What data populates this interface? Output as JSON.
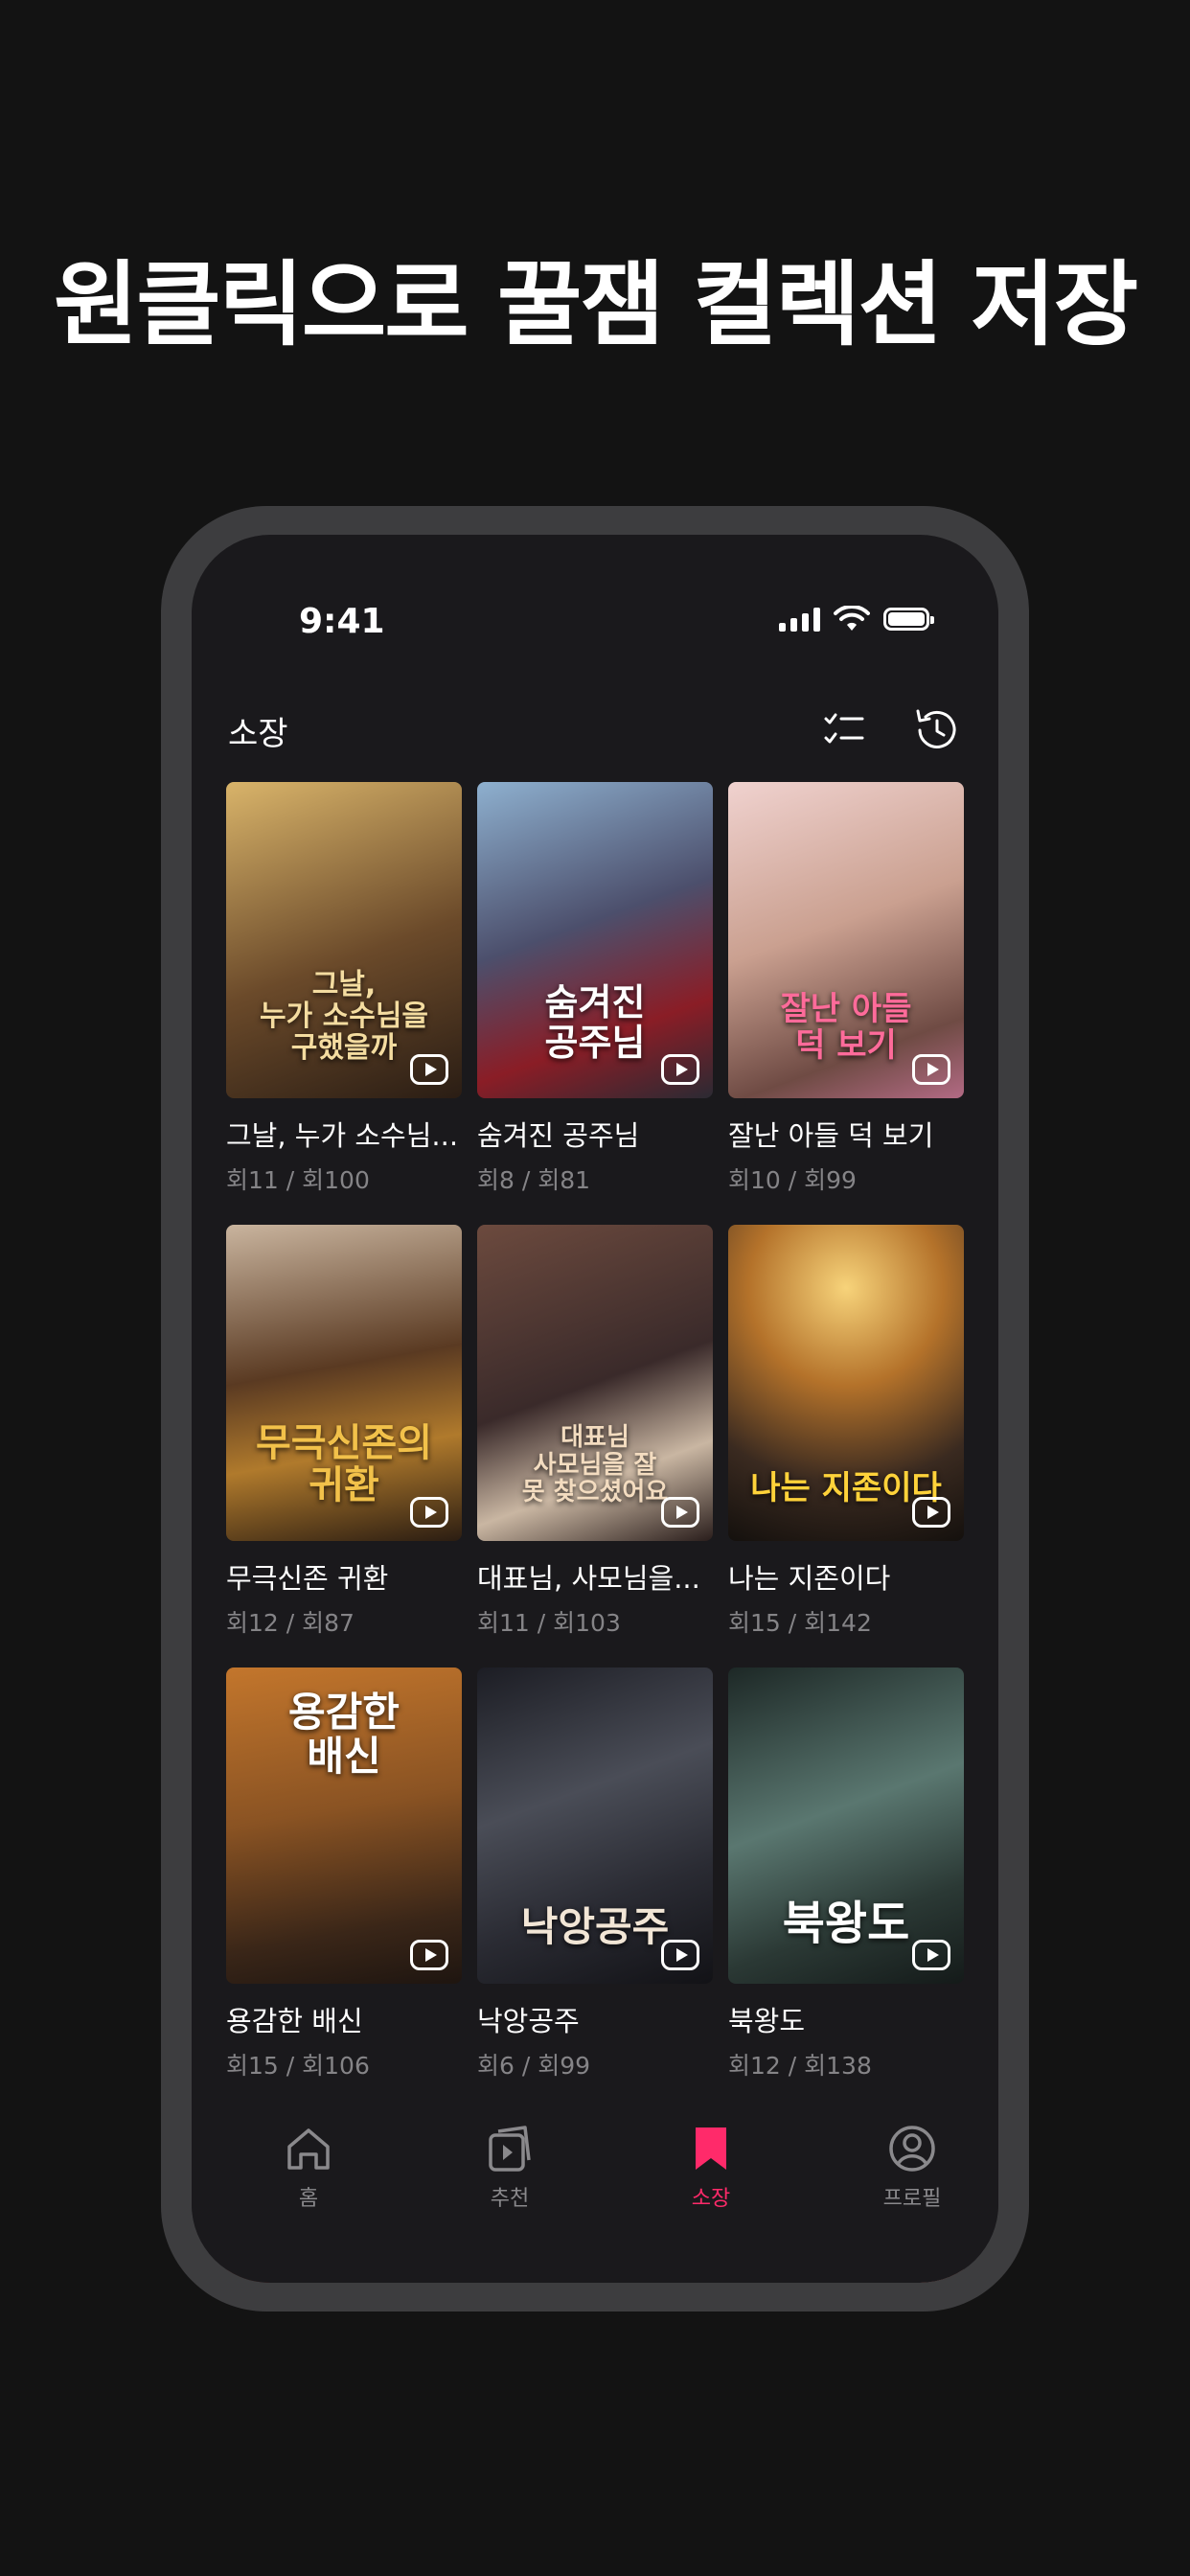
{
  "headline": "원클릭으로 꿀잼 컬렉션 저장",
  "status": {
    "time": "9:41"
  },
  "nav": {
    "title": "소장"
  },
  "items": [
    {
      "title": "그날, 누가 소수님...",
      "episode": "회11 / 회100",
      "poster_text": "그날,\n누가 소수님을\n구했을까",
      "poster_color": "#b0873e"
    },
    {
      "title": "숨겨진 공주님",
      "episode": "회8 / 회81",
      "poster_text": "숨겨진\n공주님",
      "poster_color": "#6e7a97"
    },
    {
      "title": "잘난 아들 덕 보기",
      "episode": "회10 / 회99",
      "poster_text": "잘난 아들\n덕 보기",
      "poster_color": "#d3a6a9"
    },
    {
      "title": "무극신존 귀환",
      "episode": "회12 / 회87",
      "poster_text": "무극신존의\n귀환",
      "poster_color": "#8c5a2b"
    },
    {
      "title": "대표님, 사모님을...",
      "episode": "회11 / 회103",
      "poster_text": "대표님\n사모님을 잘\n못 찾으셨어요",
      "poster_color": "#5a3e38"
    },
    {
      "title": "나는 지존이다",
      "episode": "회15 / 회142",
      "poster_text": "나는 지존이다",
      "poster_color": "#8c5e24"
    },
    {
      "title": "용감한 배신",
      "episode": "회15 / 회106",
      "poster_text": "용감한\n배신",
      "poster_color": "#7a4a22"
    },
    {
      "title": "낙앙공주",
      "episode": "회6 / 회99",
      "poster_text": "낙앙공주",
      "poster_color": "#2c2d35"
    },
    {
      "title": "북왕도",
      "episode": "회12 / 회138",
      "poster_text": "북왕도",
      "poster_color": "#3f5551"
    }
  ],
  "tabs": [
    {
      "label": "홈",
      "icon": "home-icon"
    },
    {
      "label": "추천",
      "icon": "play-stack-icon"
    },
    {
      "label": "소장",
      "icon": "bookmark-icon",
      "active": true
    },
    {
      "label": "프로필",
      "icon": "profile-icon"
    }
  ],
  "colors": {
    "accent": "#ff2a6a",
    "background": "#131313",
    "screen": "#1a191c"
  }
}
